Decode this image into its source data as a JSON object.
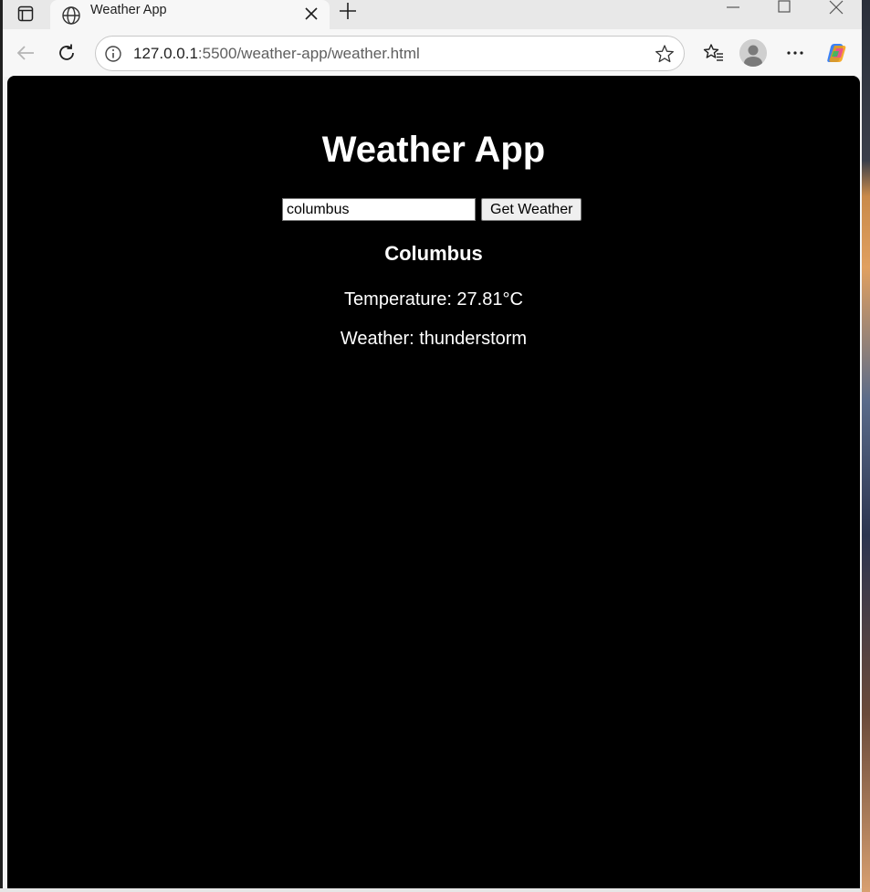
{
  "browser": {
    "tab": {
      "title": "Weather App"
    },
    "address": {
      "host": "127.0.0.1",
      "path": ":5500/weather-app/weather.html"
    },
    "icons": {
      "tab_actions": "tab-actions-icon",
      "tab_favicon": "globe-icon",
      "tab_close": "close-icon",
      "new_tab": "plus-icon",
      "minimize": "minimize-icon",
      "maximize": "maximize-icon",
      "window_close": "close-icon",
      "back": "back-arrow-icon",
      "reload": "reload-icon",
      "site_info": "info-icon",
      "favorite": "star-icon",
      "favorites": "favorites-icon",
      "profile": "avatar-icon",
      "more": "more-icon",
      "copilot": "copilot-icon"
    }
  },
  "app": {
    "title": "Weather App",
    "search": {
      "value": "columbus"
    },
    "button_label": "Get Weather",
    "result": {
      "city": "Columbus",
      "temperature_text": "Temperature: 27.81°C",
      "weather_text": "Weather: thunderstorm"
    }
  },
  "colors": {
    "background": "#000000",
    "text": "#ffffff"
  }
}
